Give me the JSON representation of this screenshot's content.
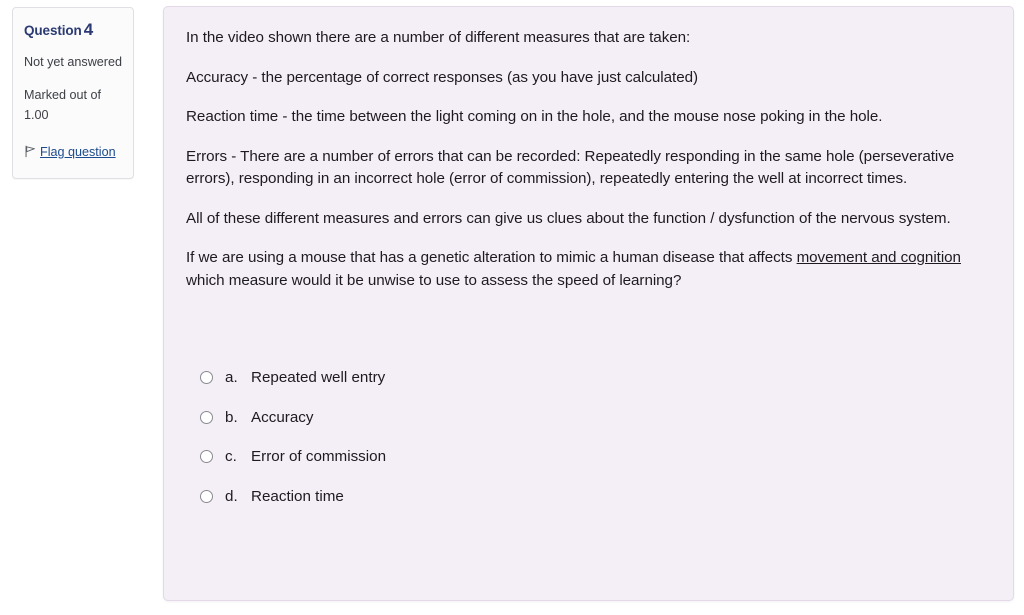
{
  "info_panel": {
    "question_word": "Question",
    "question_number": "4",
    "state": "Not yet answered",
    "marked_out_of": "Marked out of 1.00",
    "flag_label": "Flag question",
    "flag_icon": "flag-icon",
    "accent_color": "#2b3a72",
    "link_color": "#1d4b8f"
  },
  "question": {
    "background_color": "#f4eef6",
    "border_color": "#e4d8e9",
    "paragraphs": [
      {
        "id": "intro",
        "text": "In the video shown there are a number of different measures that are taken:"
      },
      {
        "id": "accuracy",
        "text": "Accuracy - the percentage of correct responses (as you have just calculated)"
      },
      {
        "id": "reaction-time",
        "text": "Reaction time - the time between the light coming on in the hole, and the mouse nose poking in the hole."
      },
      {
        "id": "errors",
        "text": "Errors - There are a number of errors that can be recorded: Repeatedly responding in the same hole (perseverative errors), responding in an incorrect hole (error of commission), repeatedly entering the well at incorrect times."
      },
      {
        "id": "summary",
        "text": "All of these different measures and errors can give us clues about the function / dysfunction of the nervous system."
      }
    ],
    "prompt": {
      "lead": "If we are using a mouse that has a genetic alteration to mimic a human disease that affects ",
      "underlined": "movement and cognition",
      "tail": " which measure would it be unwise to use to assess the speed of learning?"
    }
  },
  "answers": {
    "options": [
      {
        "key": "a.",
        "label": "Repeated well entry",
        "selected": false
      },
      {
        "key": "b.",
        "label": "Accuracy",
        "selected": false
      },
      {
        "key": "c.",
        "label": "Error of commission",
        "selected": false
      },
      {
        "key": "d.",
        "label": "Reaction time",
        "selected": false
      }
    ]
  }
}
